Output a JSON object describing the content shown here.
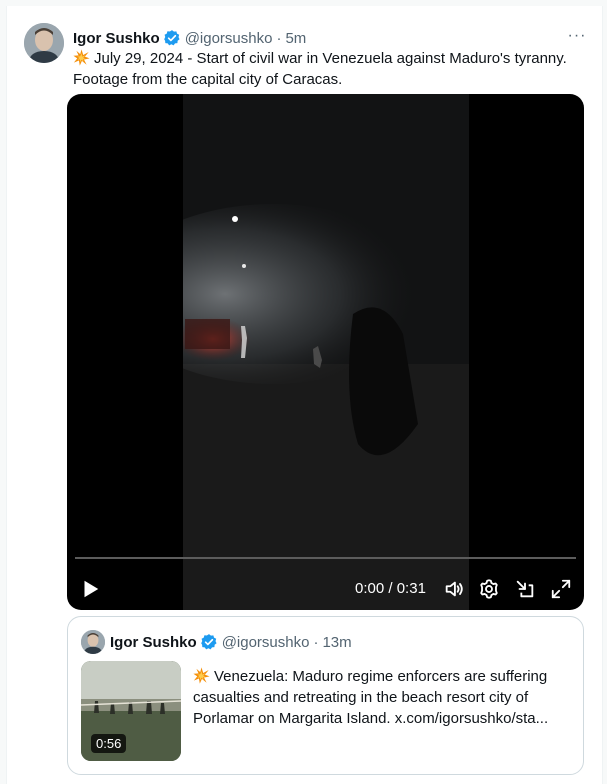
{
  "tweet": {
    "author_name": "Igor Sushko",
    "author_handle": "@igorsushko",
    "separator": "·",
    "time": "5m",
    "more_label": "···",
    "emoji_icon": "collision-icon",
    "text": "July 29, 2024 - Start of civil war in Venezuela against Maduro's tyranny. Footage from the capital city of Caracas."
  },
  "video": {
    "current_time": "0:00",
    "time_sep": " / ",
    "duration": "0:31",
    "progress": 0.0,
    "controls": [
      "play-icon",
      "volume-icon",
      "settings-icon",
      "popout-icon",
      "fullscreen-icon"
    ]
  },
  "quoted": {
    "author_name": "Igor Sushko",
    "author_handle": "@igorsushko",
    "separator": "·",
    "time": "13m",
    "emoji_icon": "collision-icon",
    "text": "Venezuela: Maduro regime enforcers are suffering casualties and retreating in the beach resort city of Porlamar on Margarita Island.  x.com/igorsushko/sta...",
    "thumb_duration": "0:56"
  },
  "colors": {
    "verified": "#1d9bf0",
    "muted_text": "#536471",
    "border": "#cfd9de",
    "text": "#0f1419"
  }
}
